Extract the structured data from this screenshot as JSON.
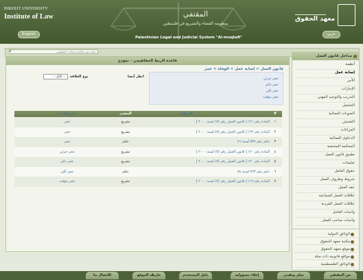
{
  "header": {
    "university": "BIRZEIT UNIVERSITY",
    "institute_en": "Institute of Law",
    "english_button": "English",
    "arabic_button": "عربي",
    "mq_title_ar": "المقتفي",
    "mq_subtitle_ar": "منظومة القضاء والتشريع في فلسطين",
    "mq_title_en": "Palestinian Legal and Judicial System \"Al-muqtafi\"",
    "institute_ar": "معهد الحقوق"
  },
  "search": {
    "placeholder": "بحث في قاعدة بيانات المقتفي",
    "dropdown_icon": "chevron-down-icon"
  },
  "main": {
    "title": "قاعدة الربط المفاهيمي - نموذج",
    "breadcrumb": "قانون العمل > إصابة عمل > الوفاة > عجز",
    "filter_label": "نوع العلاقة",
    "filter_value": "-- الكل --",
    "see_also": "انظر أيضا",
    "related_terms": [
      "عجز جزئي",
      "عجز دائم",
      "عجز كلي",
      "عجز مؤقت"
    ]
  },
  "table": {
    "headers": {
      "num": "#",
      "title": "العنوان",
      "source": "المصدر",
      "related": "مرتبط ب"
    },
    "rows": [
      {
        "num": "١",
        "title": "المادة رقم ١٢١ [ قانون العمل رقم (٧) لسنة ٢٠٠٠ ]",
        "source": "تشريع",
        "related": "عجز"
      },
      {
        "num": "٢",
        "title": "المادة رقم ١٢٢ [ قانون العمل رقم (٧) لسنة ٢٠٠٠ ]",
        "source": "تشريع",
        "related": "عجز"
      },
      {
        "num": "٣",
        "title": "حكم رقم ٥٣٩ لسنة ٩٦",
        "source": "حكم",
        "related": "عجز"
      },
      {
        "num": "٤",
        "title": "المادة رقم ١٢٠ [ قانون العمل رقم (٧) لسنة ٢٠٠٠ ]",
        "source": "تشريع",
        "related": "عجز جزئي"
      },
      {
        "num": "٥",
        "title": "المادة رقم ١٢٠ [ قانون العمل رقم (٧) لسنة ٢٠٠٠ ]",
        "source": "تشريع",
        "related": "عجز دائم"
      },
      {
        "num": "٦",
        "title": "حكم رقم ٧٢٣ لسنة ٩٨",
        "source": "حكم",
        "related": "عجز كلي"
      },
      {
        "num": "٧",
        "title": "المادة رقم ١١٩ [ قانون العمل رقم (٧) لسنة ٢٠٠٠ ]",
        "source": "تشريع",
        "related": "عجز مؤقت"
      }
    ]
  },
  "sidebar": {
    "header": "مداخل قانون العمل",
    "items": [
      "أنظمة",
      "إصابة عمل",
      "الأجر",
      "الإجازات",
      "التدريب والتوجيه المهني",
      "التشغيل",
      "الصوبات العمالية",
      "التفتيش",
      "الجزاءات",
      "الدعاوى العمالية",
      "المحكمة المختصة",
      "تطبيق قانون العمل",
      "تعليمات",
      "حقوق العامل",
      "شروط وظروف العمل",
      "عقد العمل",
      "علاقات العمل الجماعية",
      "علاقات العمل الفردية",
      "واجبات العامل",
      "واجبات صاحب العمل"
    ],
    "selected_index": 1
  },
  "bottom_links": [
    "الوثائق الدولية",
    "مكتبة معهد الحقوق",
    "موقع معهد الحقوق",
    "مواقع قانونية ذات صلة",
    "الوثائق الفلسطينية"
  ],
  "footer": {
    "tabs": [
      "عن المقتفي",
      "شكر وتقدير",
      "إخلاء مسؤولية",
      "دليل المستخدم",
      "خارطة الموقع",
      "للاتصال بنا"
    ]
  }
}
